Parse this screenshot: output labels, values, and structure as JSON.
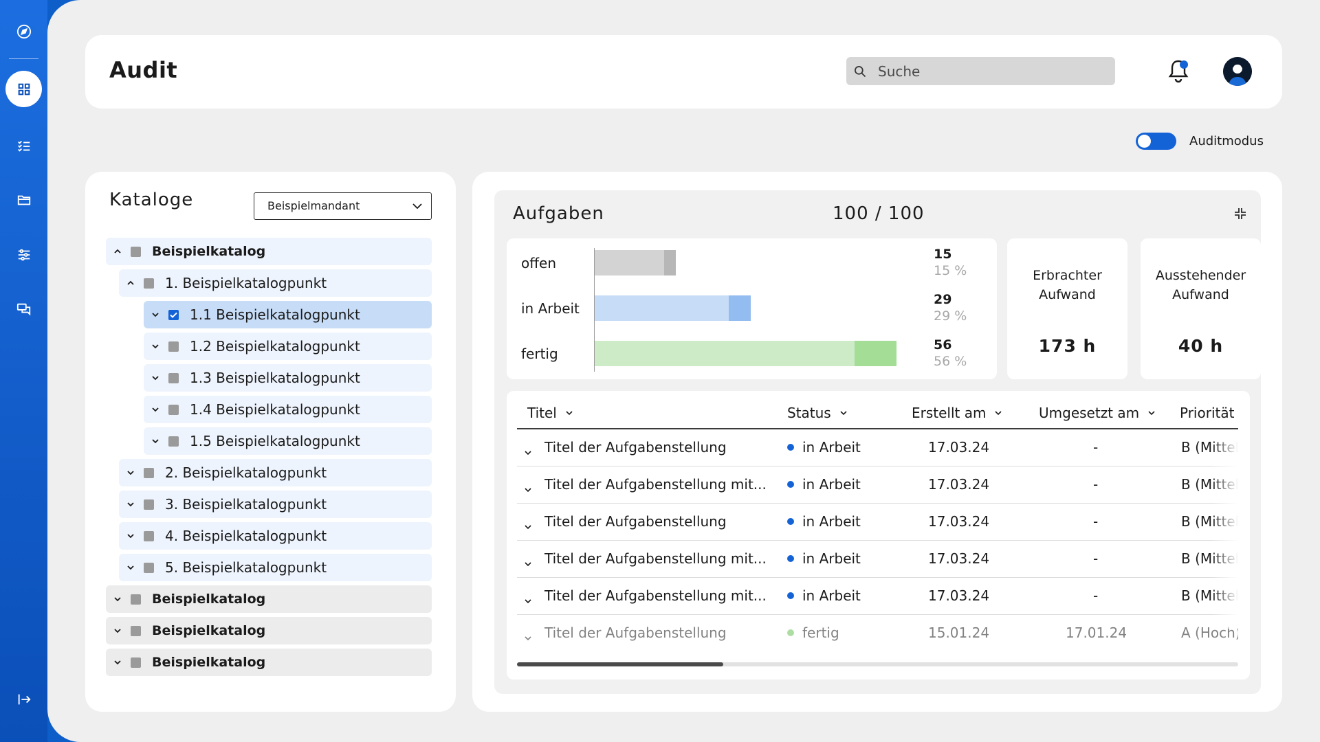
{
  "sidebar": {
    "items": [
      {
        "icon": "compass-icon"
      },
      {
        "icon": "dashboard-icon",
        "active": true
      },
      {
        "icon": "checklist-icon"
      },
      {
        "icon": "folder-icon"
      },
      {
        "icon": "sliders-icon"
      },
      {
        "icon": "chat-icon"
      }
    ],
    "bottom_icon": "logout-icon"
  },
  "header": {
    "title": "Audit",
    "search_placeholder": "Suche",
    "notifications_icon": "bell-icon",
    "avatar_icon": "user-avatar-icon"
  },
  "audit_toggle": {
    "label": "Auditmodus",
    "on": true
  },
  "catalog": {
    "title": "Kataloge",
    "selected_client": "Beispielmandant",
    "tree": [
      {
        "label": "Beispielkatalog",
        "expanded": true
      },
      {
        "label": "1. Beispielkatalogpunkt",
        "expanded": true
      },
      {
        "label": "1.1 Beispielkatalogpunkt",
        "checked": true
      },
      {
        "label": "1.2 Beispielkatalogpunkt"
      },
      {
        "label": "1.3 Beispielkatalogpunkt"
      },
      {
        "label": "1.4 Beispielkatalogpunkt"
      },
      {
        "label": "1.5 Beispielkatalogpunkt"
      },
      {
        "label": "2. Beispielkatalogpunkt"
      },
      {
        "label": "3. Beispielkatalogpunkt"
      },
      {
        "label": "4. Beispielkatalogpunkt"
      },
      {
        "label": "5. Beispielkatalogpunkt"
      },
      {
        "label": "Beispielkatalog"
      },
      {
        "label": "Beispielkatalog"
      },
      {
        "label": "Beispielkatalog"
      }
    ]
  },
  "tasks": {
    "title": "Aufgaben",
    "count": "100 / 100",
    "status_stats": [
      {
        "label": "offen",
        "count": "15",
        "percent": "15 %",
        "share": 0.15,
        "color_light": "#d3d3d3",
        "color_dark": "#b7b7b7"
      },
      {
        "label": "in Arbeit",
        "count": "29",
        "percent": "29 %",
        "share": 0.29,
        "color_light": "#c6dcf7",
        "color_dark": "#93bcf0"
      },
      {
        "label": "fertig",
        "count": "56",
        "percent": "56 %",
        "share": 0.56,
        "color_light": "#cdebc7",
        "color_dark": "#a3dd96"
      }
    ],
    "effort_done": {
      "label": "Erbrachter Aufwand",
      "value": "173 h"
    },
    "effort_pending": {
      "label": "Ausstehender Aufwand",
      "value": "40 h"
    },
    "table": {
      "columns": [
        "Titel",
        "Status",
        "Erstellt am",
        "Umgesetzt am",
        "Priorität"
      ],
      "rows": [
        {
          "title": "Titel der Aufgabenstellung",
          "status": "in Arbeit",
          "status_color": "#1463d6",
          "created": "17.03.24",
          "done": "-",
          "priority": "B (Mittel)"
        },
        {
          "title": "Titel der Aufgabenstellung mit...",
          "status": "in Arbeit",
          "status_color": "#1463d6",
          "created": "17.03.24",
          "done": "-",
          "priority": "B (Mittel)"
        },
        {
          "title": "Titel der Aufgabenstellung",
          "status": "in Arbeit",
          "status_color": "#1463d6",
          "created": "17.03.24",
          "done": "-",
          "priority": "B (Mittel)"
        },
        {
          "title": "Titel der Aufgabenstellung mit...",
          "status": "in Arbeit",
          "status_color": "#1463d6",
          "created": "17.03.24",
          "done": "-",
          "priority": "B (Mittel)"
        },
        {
          "title": "Titel der Aufgabenstellung mit...",
          "status": "in Arbeit",
          "status_color": "#1463d6",
          "created": "17.03.24",
          "done": "-",
          "priority": "B (Mittel)"
        },
        {
          "title": "Titel der Aufgabenstellung",
          "status": "fertig",
          "status_color": "#6cc35b",
          "created": "15.01.24",
          "done": "17.01.24",
          "priority": "A (Hoch)"
        }
      ]
    }
  }
}
